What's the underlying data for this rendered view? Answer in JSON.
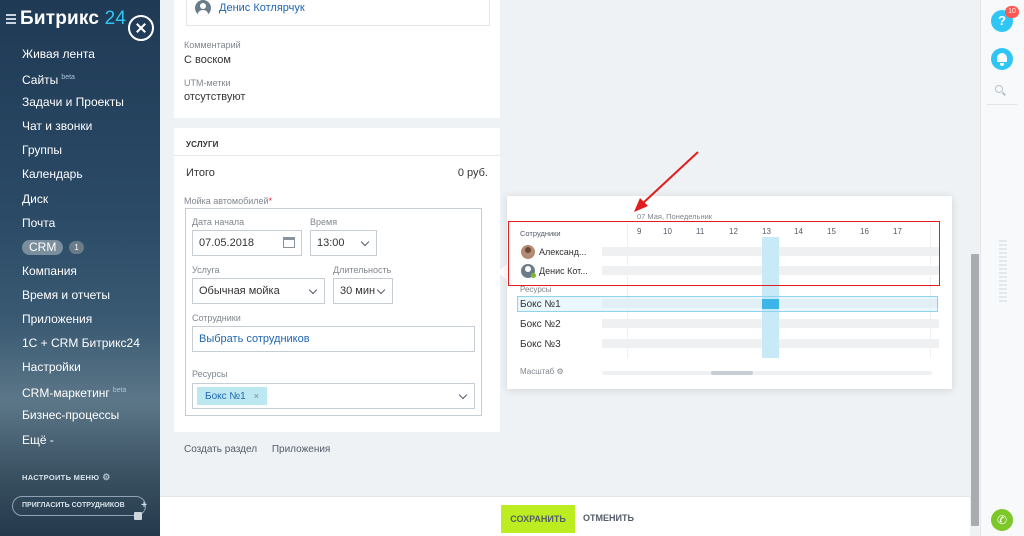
{
  "app": {
    "logo_main": "Битрикс",
    "logo_num": "24"
  },
  "sidebar": {
    "items": [
      {
        "label": "Живая лента"
      },
      {
        "label": "Сайты",
        "sup": "beta"
      },
      {
        "label": "Задачи и Проекты"
      },
      {
        "label": "Чат и звонки"
      },
      {
        "label": "Группы"
      },
      {
        "label": "Календарь"
      },
      {
        "label": "Диск"
      },
      {
        "label": "Почта"
      },
      {
        "label": "CRM",
        "count": "1"
      },
      {
        "label": "Компания"
      },
      {
        "label": "Время и отчеты"
      },
      {
        "label": "Приложения"
      },
      {
        "label": "1С + CRM Битрикс24"
      },
      {
        "label": "Настройки"
      },
      {
        "label": "CRM-маркетинг",
        "sup": "beta"
      },
      {
        "label": "Бизнес-процессы"
      },
      {
        "label": "Ещё -"
      }
    ],
    "settings_menu": "НАСТРОИТЬ МЕНЮ",
    "invite": "ПРИГЛАСИТЬ СОТРУДНИКОВ"
  },
  "form": {
    "contact_name": "Денис Котлярчук",
    "comment_label": "Комментарий",
    "comment_value": "С воском",
    "utm_label": "UTM-метки",
    "utm_value": "отсутствуют",
    "services_title": "УСЛУГИ",
    "total_label": "Итого",
    "total_value": "0 руб.",
    "wash_label": "Мойка автомобилей",
    "wash_required": "*",
    "start_date_label": "Дата начала",
    "start_date_value": "07.05.2018",
    "time_label": "Время",
    "time_value": "13:00",
    "service_label": "Услуга",
    "service_value": "Обычная мойка",
    "duration_label": "Длительность",
    "duration_value": "30 мин",
    "employees_label": "Сотрудники",
    "employees_link": "Выбрать сотрудников",
    "resources_label": "Ресурсы",
    "resource_tag": "Бокс №1",
    "resource_tag_remove": "×",
    "add_section": "Создать раздел",
    "apps_link": "Приложения"
  },
  "scheduler": {
    "date": "07 Мая, Понедельник",
    "employees_label": "Сотрудники",
    "hours": [
      "9",
      "10",
      "11",
      "12",
      "13",
      "14",
      "15",
      "16",
      "17"
    ],
    "employees": [
      {
        "name": "Александ..."
      },
      {
        "name": "Денис Кот..."
      }
    ],
    "resources_label": "Ресурсы",
    "resources": [
      {
        "name": "Бокс №1"
      },
      {
        "name": "Бокс №2"
      },
      {
        "name": "Бокс №3"
      }
    ],
    "scale_label": "Масштаб"
  },
  "footer": {
    "save": "СОХРАНИТЬ",
    "cancel": "ОТМЕНИТЬ"
  },
  "rail": {
    "help": "?",
    "help_badge": "10",
    "phone": "✆"
  },
  "colors": {
    "accent": "#2fc6f6",
    "save": "#bbed21",
    "highlight": "#e21d1d",
    "link": "#2067b0"
  }
}
